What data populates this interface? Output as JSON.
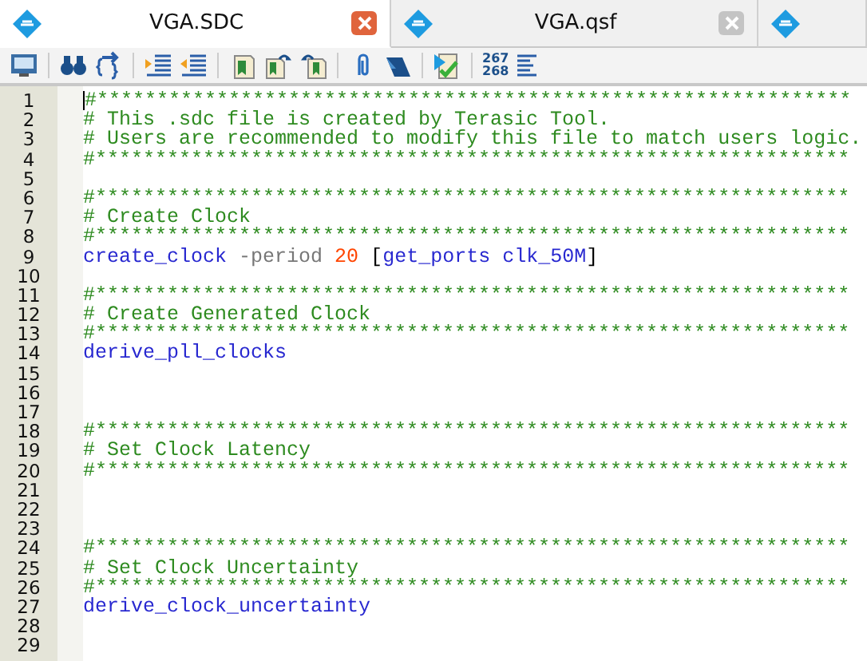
{
  "tabs": [
    {
      "label": "VGA.SDC",
      "selected": true
    },
    {
      "label": "VGA.qsf",
      "selected": false
    },
    {
      "selected": false
    }
  ],
  "toolbar": {
    "line_number_labels": [
      "267",
      "268"
    ]
  },
  "lines": [
    {
      "number": "1",
      "cursor": true,
      "segments": [
        {
          "kind": "comment",
          "text": "#***************************************************************"
        }
      ]
    },
    {
      "number": "2",
      "cursor": false,
      "segments": [
        {
          "kind": "comment",
          "text": "# This .sdc file is created by Terasic Tool."
        }
      ]
    },
    {
      "number": "3",
      "cursor": false,
      "segments": [
        {
          "kind": "comment",
          "text": "# Users are recommended to modify this file to match users logic."
        }
      ]
    },
    {
      "number": "4",
      "cursor": false,
      "segments": [
        {
          "kind": "comment",
          "text": "#***************************************************************"
        }
      ]
    },
    {
      "number": "5",
      "cursor": false
    },
    {
      "number": "6",
      "cursor": false,
      "segments": [
        {
          "kind": "comment",
          "text": "#***************************************************************"
        }
      ]
    },
    {
      "number": "7",
      "cursor": false,
      "segments": [
        {
          "kind": "comment",
          "text": "# Create Clock"
        }
      ]
    },
    {
      "number": "8",
      "cursor": false,
      "segments": [
        {
          "kind": "comment",
          "text": "#***************************************************************"
        }
      ]
    },
    {
      "number": "9",
      "cursor": false,
      "segments": [
        {
          "kind": "command",
          "text": "create_clock"
        },
        {
          "kind": "option",
          "text": " -period "
        },
        {
          "kind": "number",
          "text": "20"
        },
        {
          "kind": "bracket",
          "text": " ["
        },
        {
          "kind": "command",
          "text": "get_ports clk_50M"
        },
        {
          "kind": "bracket",
          "text": "]"
        }
      ]
    },
    {
      "number": "10",
      "cursor": false
    },
    {
      "number": "11",
      "cursor": false,
      "segments": [
        {
          "kind": "comment",
          "text": "#***************************************************************"
        }
      ]
    },
    {
      "number": "12",
      "cursor": false,
      "segments": [
        {
          "kind": "comment",
          "text": "# Create Generated Clock"
        }
      ]
    },
    {
      "number": "13",
      "cursor": false,
      "segments": [
        {
          "kind": "comment",
          "text": "#***************************************************************"
        }
      ]
    },
    {
      "number": "14",
      "cursor": false,
      "segments": [
        {
          "kind": "command",
          "text": "derive_pll_clocks"
        }
      ]
    },
    {
      "number": "15",
      "cursor": false
    },
    {
      "number": "16",
      "cursor": false
    },
    {
      "number": "17",
      "cursor": false
    },
    {
      "number": "18",
      "cursor": false,
      "segments": [
        {
          "kind": "comment",
          "text": "#***************************************************************"
        }
      ]
    },
    {
      "number": "19",
      "cursor": false,
      "segments": [
        {
          "kind": "comment",
          "text": "# Set Clock Latency"
        }
      ]
    },
    {
      "number": "20",
      "cursor": false,
      "segments": [
        {
          "kind": "comment",
          "text": "#***************************************************************"
        }
      ]
    },
    {
      "number": "21",
      "cursor": false
    },
    {
      "number": "22",
      "cursor": false
    },
    {
      "number": "23",
      "cursor": false
    },
    {
      "number": "24",
      "cursor": false,
      "segments": [
        {
          "kind": "comment",
          "text": "#***************************************************************"
        }
      ]
    },
    {
      "number": "25",
      "cursor": false,
      "segments": [
        {
          "kind": "comment",
          "text": "# Set Clock Uncertainty"
        }
      ]
    },
    {
      "number": "26",
      "cursor": false,
      "segments": [
        {
          "kind": "comment",
          "text": "#***************************************************************"
        }
      ]
    },
    {
      "number": "27",
      "cursor": false,
      "segments": [
        {
          "kind": "command",
          "text": "derive_clock_uncertainty"
        }
      ]
    },
    {
      "number": "28",
      "cursor": false
    },
    {
      "number": "29",
      "cursor": false
    }
  ]
}
